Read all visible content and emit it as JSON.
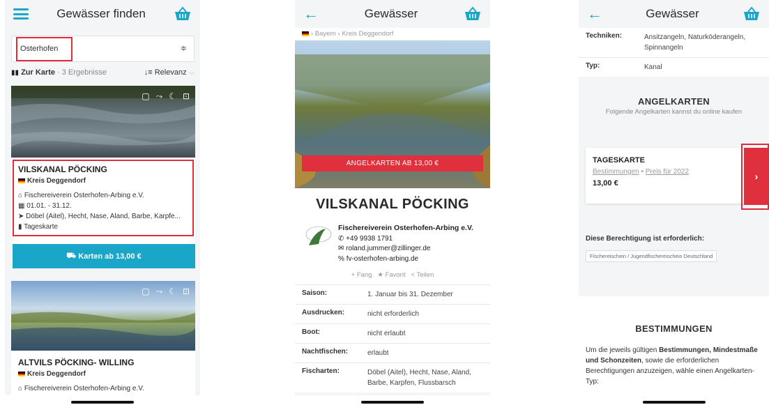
{
  "screen1": {
    "title": "Gewässer finden",
    "search": {
      "value": "Osterhofen"
    },
    "results": {
      "map_label": "Zur Karte",
      "count": " · 3 Ergebnisse",
      "sort": "Relevanz"
    },
    "card1": {
      "name": "VILSKANAL PÖCKING",
      "district": "Kreis Deggendorf",
      "club": "Fischereiverein Osterhofen-Arbing e.V.",
      "season": "01.01. - 31.12.",
      "fish": "Döbel (Aitel), Hecht, Nase, Aland, Barbe, Karpfe...",
      "ticket": "Tageskarte"
    },
    "cta": "Karten ab 13,00 €",
    "card2": {
      "name": "ALTVILS PÖCKING- WILLING",
      "district": "Kreis Deggendorf",
      "club": "Fischereiverein Osterhofen-Arbing e.V."
    }
  },
  "screen2": {
    "title": "Gewässer",
    "breadcrumb": "› Bayern › Kreis Deggendorf",
    "buy_button": "ANGELKARTEN AB 13,00 €",
    "name": "VILSKANAL PÖCKING",
    "club": {
      "name": "Fischereiverein Osterhofen-Arbing e.V.",
      "phone": "+49 9938 1791",
      "email": "roland.jummer@zillinger.de",
      "web": "fv-osterhofen-arbing.de"
    },
    "actions": {
      "catch": "Fang",
      "favorite": "Favorit",
      "share": "Teilen"
    },
    "rows": [
      {
        "k": "Saison:",
        "v": "1. Januar bis 31. Dezember"
      },
      {
        "k": "Ausdrucken:",
        "v": "nicht erforderlich"
      },
      {
        "k": "Boot:",
        "v": "nicht erlaubt"
      },
      {
        "k": "Nachtfischen:",
        "v": "erlaubt"
      },
      {
        "k": "Fischarten:",
        "v": "Döbel (Aitel), Hecht, Nase, Aland, Barbe, Karpfen, Flussbarsch"
      }
    ]
  },
  "screen3": {
    "title": "Gewässer",
    "rows": [
      {
        "k": "Techniken:",
        "v": "Ansitzangeln, Naturköderangeln, Spinnangeln"
      },
      {
        "k": "Typ:",
        "v": "Kanal"
      }
    ],
    "angelkarten_title": "ANGELKARTEN",
    "angelkarten_sub": "Folgende Angelkarten kannst du online kaufen",
    "ticket": {
      "name": "TAGESKARTE",
      "link1": "Bestimmungen",
      "sep": " • ",
      "link2": "Preis für 2022",
      "price": "13,00 €"
    },
    "requirement_label": "Diese Berechtigung ist erforderlich:",
    "requirement_chip": "Fischereischein / Jugendfischereischein Deutschland",
    "bestimmungen_title": "BESTIMMUNGEN",
    "bestimmungen_pre": "Um die jeweils gültigen ",
    "bestimmungen_b1": "Bestimmungen, Mindestmaße und Schonzeiten",
    "bestimmungen_post": ", sowie die erforderlichen Berechtigungen anzuzeigen, wähle einen Angelkarten-Typ:"
  },
  "colors": {
    "accent": "#1aa6c9",
    "red": "#e0303e",
    "highlight": "#e12a3b"
  },
  "icons": [
    "menu-icon",
    "basket-icon",
    "back-arrow-icon",
    "filter-icon",
    "map-icon",
    "sort-icon",
    "home-icon",
    "calendar-icon",
    "fish-icon",
    "ticket-icon",
    "phone-icon",
    "mail-icon",
    "link-icon",
    "chevron-right-icon"
  ]
}
